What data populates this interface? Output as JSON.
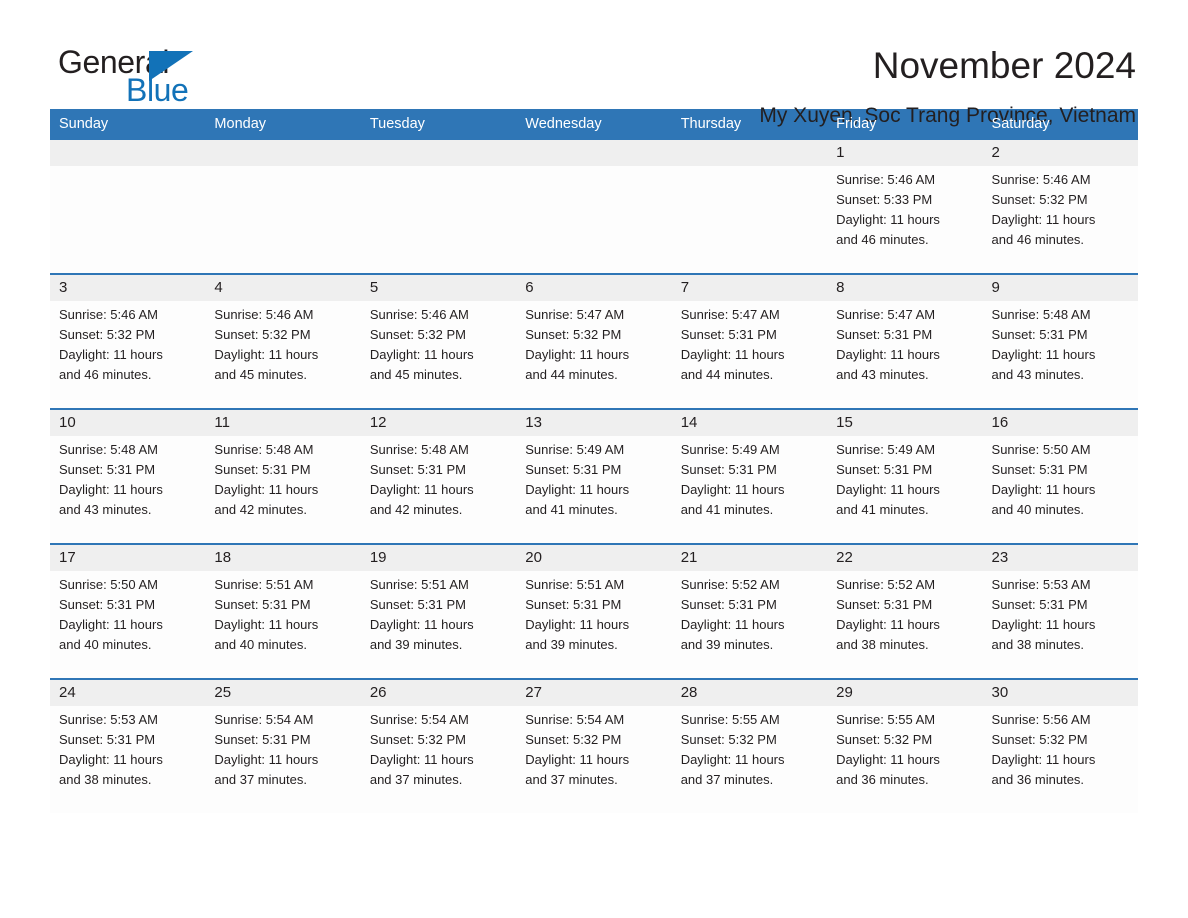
{
  "brand": {
    "name_part1": "General",
    "name_part2": "Blue"
  },
  "header": {
    "title": "November 2024",
    "subtitle": "My Xuyen, Soc Trang Province, Vietnam"
  },
  "calendar": {
    "weekdays": [
      "Sunday",
      "Monday",
      "Tuesday",
      "Wednesday",
      "Thursday",
      "Friday",
      "Saturday"
    ],
    "accent_color": "#2f76b6",
    "daynum_bg": "#efefef",
    "weeks": [
      [
        {
          "day": "",
          "sunrise": "",
          "sunset": "",
          "daylight_line1": "",
          "daylight_line2": ""
        },
        {
          "day": "",
          "sunrise": "",
          "sunset": "",
          "daylight_line1": "",
          "daylight_line2": ""
        },
        {
          "day": "",
          "sunrise": "",
          "sunset": "",
          "daylight_line1": "",
          "daylight_line2": ""
        },
        {
          "day": "",
          "sunrise": "",
          "sunset": "",
          "daylight_line1": "",
          "daylight_line2": ""
        },
        {
          "day": "",
          "sunrise": "",
          "sunset": "",
          "daylight_line1": "",
          "daylight_line2": ""
        },
        {
          "day": "1",
          "sunrise": "Sunrise: 5:46 AM",
          "sunset": "Sunset: 5:33 PM",
          "daylight_line1": "Daylight: 11 hours",
          "daylight_line2": "and 46 minutes."
        },
        {
          "day": "2",
          "sunrise": "Sunrise: 5:46 AM",
          "sunset": "Sunset: 5:32 PM",
          "daylight_line1": "Daylight: 11 hours",
          "daylight_line2": "and 46 minutes."
        }
      ],
      [
        {
          "day": "3",
          "sunrise": "Sunrise: 5:46 AM",
          "sunset": "Sunset: 5:32 PM",
          "daylight_line1": "Daylight: 11 hours",
          "daylight_line2": "and 46 minutes."
        },
        {
          "day": "4",
          "sunrise": "Sunrise: 5:46 AM",
          "sunset": "Sunset: 5:32 PM",
          "daylight_line1": "Daylight: 11 hours",
          "daylight_line2": "and 45 minutes."
        },
        {
          "day": "5",
          "sunrise": "Sunrise: 5:46 AM",
          "sunset": "Sunset: 5:32 PM",
          "daylight_line1": "Daylight: 11 hours",
          "daylight_line2": "and 45 minutes."
        },
        {
          "day": "6",
          "sunrise": "Sunrise: 5:47 AM",
          "sunset": "Sunset: 5:32 PM",
          "daylight_line1": "Daylight: 11 hours",
          "daylight_line2": "and 44 minutes."
        },
        {
          "day": "7",
          "sunrise": "Sunrise: 5:47 AM",
          "sunset": "Sunset: 5:31 PM",
          "daylight_line1": "Daylight: 11 hours",
          "daylight_line2": "and 44 minutes."
        },
        {
          "day": "8",
          "sunrise": "Sunrise: 5:47 AM",
          "sunset": "Sunset: 5:31 PM",
          "daylight_line1": "Daylight: 11 hours",
          "daylight_line2": "and 43 minutes."
        },
        {
          "day": "9",
          "sunrise": "Sunrise: 5:48 AM",
          "sunset": "Sunset: 5:31 PM",
          "daylight_line1": "Daylight: 11 hours",
          "daylight_line2": "and 43 minutes."
        }
      ],
      [
        {
          "day": "10",
          "sunrise": "Sunrise: 5:48 AM",
          "sunset": "Sunset: 5:31 PM",
          "daylight_line1": "Daylight: 11 hours",
          "daylight_line2": "and 43 minutes."
        },
        {
          "day": "11",
          "sunrise": "Sunrise: 5:48 AM",
          "sunset": "Sunset: 5:31 PM",
          "daylight_line1": "Daylight: 11 hours",
          "daylight_line2": "and 42 minutes."
        },
        {
          "day": "12",
          "sunrise": "Sunrise: 5:48 AM",
          "sunset": "Sunset: 5:31 PM",
          "daylight_line1": "Daylight: 11 hours",
          "daylight_line2": "and 42 minutes."
        },
        {
          "day": "13",
          "sunrise": "Sunrise: 5:49 AM",
          "sunset": "Sunset: 5:31 PM",
          "daylight_line1": "Daylight: 11 hours",
          "daylight_line2": "and 41 minutes."
        },
        {
          "day": "14",
          "sunrise": "Sunrise: 5:49 AM",
          "sunset": "Sunset: 5:31 PM",
          "daylight_line1": "Daylight: 11 hours",
          "daylight_line2": "and 41 minutes."
        },
        {
          "day": "15",
          "sunrise": "Sunrise: 5:49 AM",
          "sunset": "Sunset: 5:31 PM",
          "daylight_line1": "Daylight: 11 hours",
          "daylight_line2": "and 41 minutes."
        },
        {
          "day": "16",
          "sunrise": "Sunrise: 5:50 AM",
          "sunset": "Sunset: 5:31 PM",
          "daylight_line1": "Daylight: 11 hours",
          "daylight_line2": "and 40 minutes."
        }
      ],
      [
        {
          "day": "17",
          "sunrise": "Sunrise: 5:50 AM",
          "sunset": "Sunset: 5:31 PM",
          "daylight_line1": "Daylight: 11 hours",
          "daylight_line2": "and 40 minutes."
        },
        {
          "day": "18",
          "sunrise": "Sunrise: 5:51 AM",
          "sunset": "Sunset: 5:31 PM",
          "daylight_line1": "Daylight: 11 hours",
          "daylight_line2": "and 40 minutes."
        },
        {
          "day": "19",
          "sunrise": "Sunrise: 5:51 AM",
          "sunset": "Sunset: 5:31 PM",
          "daylight_line1": "Daylight: 11 hours",
          "daylight_line2": "and 39 minutes."
        },
        {
          "day": "20",
          "sunrise": "Sunrise: 5:51 AM",
          "sunset": "Sunset: 5:31 PM",
          "daylight_line1": "Daylight: 11 hours",
          "daylight_line2": "and 39 minutes."
        },
        {
          "day": "21",
          "sunrise": "Sunrise: 5:52 AM",
          "sunset": "Sunset: 5:31 PM",
          "daylight_line1": "Daylight: 11 hours",
          "daylight_line2": "and 39 minutes."
        },
        {
          "day": "22",
          "sunrise": "Sunrise: 5:52 AM",
          "sunset": "Sunset: 5:31 PM",
          "daylight_line1": "Daylight: 11 hours",
          "daylight_line2": "and 38 minutes."
        },
        {
          "day": "23",
          "sunrise": "Sunrise: 5:53 AM",
          "sunset": "Sunset: 5:31 PM",
          "daylight_line1": "Daylight: 11 hours",
          "daylight_line2": "and 38 minutes."
        }
      ],
      [
        {
          "day": "24",
          "sunrise": "Sunrise: 5:53 AM",
          "sunset": "Sunset: 5:31 PM",
          "daylight_line1": "Daylight: 11 hours",
          "daylight_line2": "and 38 minutes."
        },
        {
          "day": "25",
          "sunrise": "Sunrise: 5:54 AM",
          "sunset": "Sunset: 5:31 PM",
          "daylight_line1": "Daylight: 11 hours",
          "daylight_line2": "and 37 minutes."
        },
        {
          "day": "26",
          "sunrise": "Sunrise: 5:54 AM",
          "sunset": "Sunset: 5:32 PM",
          "daylight_line1": "Daylight: 11 hours",
          "daylight_line2": "and 37 minutes."
        },
        {
          "day": "27",
          "sunrise": "Sunrise: 5:54 AM",
          "sunset": "Sunset: 5:32 PM",
          "daylight_line1": "Daylight: 11 hours",
          "daylight_line2": "and 37 minutes."
        },
        {
          "day": "28",
          "sunrise": "Sunrise: 5:55 AM",
          "sunset": "Sunset: 5:32 PM",
          "daylight_line1": "Daylight: 11 hours",
          "daylight_line2": "and 37 minutes."
        },
        {
          "day": "29",
          "sunrise": "Sunrise: 5:55 AM",
          "sunset": "Sunset: 5:32 PM",
          "daylight_line1": "Daylight: 11 hours",
          "daylight_line2": "and 36 minutes."
        },
        {
          "day": "30",
          "sunrise": "Sunrise: 5:56 AM",
          "sunset": "Sunset: 5:32 PM",
          "daylight_line1": "Daylight: 11 hours",
          "daylight_line2": "and 36 minutes."
        }
      ]
    ]
  }
}
